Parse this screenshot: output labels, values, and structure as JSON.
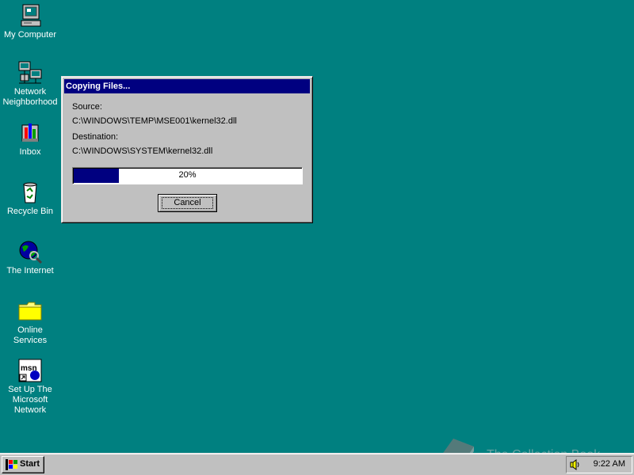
{
  "desktop": {
    "background_color": "#008080",
    "icons": [
      {
        "label": "My Computer",
        "icon": "my-computer-icon"
      },
      {
        "label": "Network\nNeighborhood",
        "icon": "network-neighborhood-icon"
      },
      {
        "label": "Inbox",
        "icon": "inbox-icon"
      },
      {
        "label": "Recycle Bin",
        "icon": "recycle-bin-icon"
      },
      {
        "label": "The Internet",
        "icon": "internet-icon"
      },
      {
        "label": "Online\nServices",
        "icon": "folder-icon"
      },
      {
        "label": "Set Up The\nMicrosoft\nNetwork",
        "icon": "msn-icon"
      }
    ]
  },
  "dialog": {
    "title": "Copying Files...",
    "source_label": "Source:",
    "source_path": "C:\\WINDOWS\\TEMP\\MSE001\\kernel32.dll",
    "destination_label": "Destination:",
    "destination_path": "C:\\WINDOWS\\SYSTEM\\kernel32.dll",
    "progress_percent": 20,
    "progress_text": "20%",
    "cancel_label": "Cancel",
    "title_color": "#000080"
  },
  "taskbar": {
    "start_label": "Start",
    "clock": "9:22 AM",
    "speaker_icon": "speaker-icon"
  },
  "watermark": {
    "text": "The Collection Book"
  }
}
